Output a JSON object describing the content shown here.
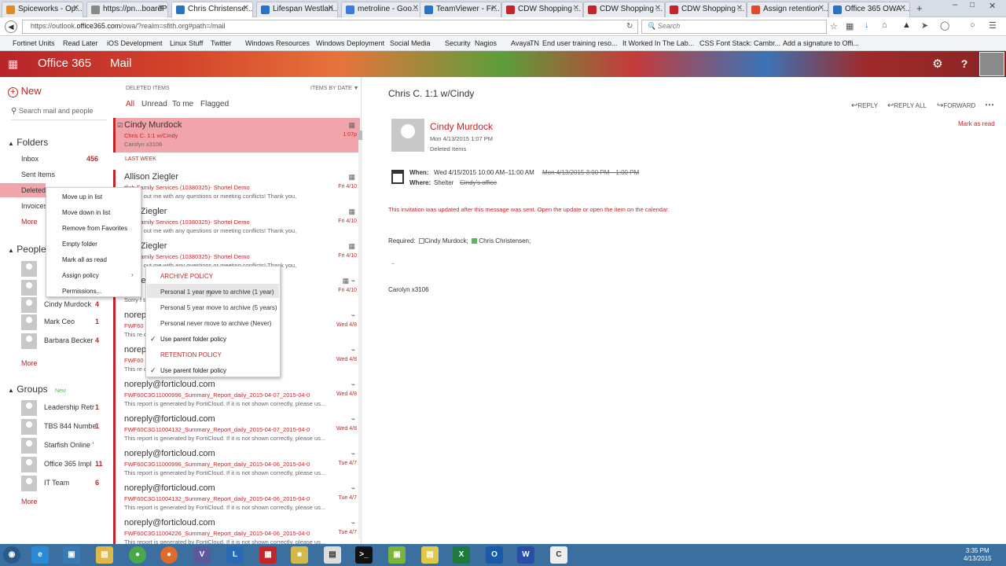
{
  "browser": {
    "tabs": [
      {
        "label": "Spiceworks - Op...",
        "color": "#e08a2a"
      },
      {
        "label": "https://pn...boardPage",
        "color": "#888888"
      },
      {
        "label": "Chris Christense...",
        "color": "#2a72c4"
      },
      {
        "label": "Lifespan Westlan...",
        "color": "#2a72c4"
      },
      {
        "label": "metroline - Goo...",
        "color": "#3a7be0"
      },
      {
        "label": "TeamViewer - Fr...",
        "color": "#2a72c4"
      },
      {
        "label": "CDW Shopping ...",
        "color": "#c2262b"
      },
      {
        "label": "CDW Shopping ...",
        "color": "#c2262b"
      },
      {
        "label": "CDW Shopping ...",
        "color": "#c2262b"
      },
      {
        "label": "Assign retention ...",
        "color": "#e04a2a"
      },
      {
        "label": "Office 365 OWA ...",
        "color": "#2a72c4"
      }
    ],
    "url_prefix": "https://outlook.",
    "url_domain": "office365.com",
    "url_rest": "/owa/?realm=sfith.org#path=/mail",
    "search_placeholder": "Search",
    "bookmarks": [
      "Fortinet Units",
      "Read Later",
      "iOS Development",
      "Linux Stuff",
      "Twitter",
      "Windows Resources",
      "Windows Deployment",
      "Social Media",
      "Security",
      "Nagios",
      "Avaya",
      "TN",
      "End user training reso...",
      "It Worked In The Lab...",
      "CSS Font Stack: Cambr...",
      "Add a signature to Offi..."
    ]
  },
  "o365": {
    "brand": "Office 365",
    "app": "Mail"
  },
  "leftnav": {
    "new_label": "New",
    "search_placeholder": "Search mail and people",
    "folders_header": "Folders",
    "folders": [
      {
        "label": "Inbox",
        "count": "456"
      },
      {
        "label": "Sent Items",
        "count": ""
      },
      {
        "label": "Deleted",
        "count": ""
      },
      {
        "label": "Invoices",
        "count": ""
      }
    ],
    "more": "More",
    "people_header": "People",
    "people": [
      {
        "name": "Cindy Murdock",
        "count": "4"
      },
      {
        "name": "Mark Ceo",
        "count": "1"
      },
      {
        "name": "Barbara Becker",
        "count": "4"
      }
    ],
    "groups_header": "Groups",
    "groups_new": "New",
    "groups": [
      {
        "name": "Leadership Retr",
        "count": "1"
      },
      {
        "name": "TBS 844 Numbe",
        "count": "1"
      },
      {
        "name": "Starfish Online '",
        "count": ""
      },
      {
        "name": "Office 365 Impl",
        "count": "11"
      },
      {
        "name": "IT Team",
        "count": "6"
      }
    ]
  },
  "context_menu": {
    "items": [
      "Move up in list",
      "Move down in list",
      "Remove from Favorites",
      "Empty folder",
      "Mark all as read",
      "Assign policy",
      "Permissions..."
    ],
    "submenu": {
      "archive_header": "ARCHIVE POLICY",
      "archive_items": [
        "Personal 1 year move to archive (1 year)",
        "Personal 5 year move to archive (5 years)",
        "Personal never move to archive (Never)",
        "Use parent folder policy"
      ],
      "retention_header": "RETENTION POLICY",
      "retention_items": [
        "Use parent folder policy"
      ]
    }
  },
  "msglist": {
    "folder_label": "DELETED ITEMS",
    "sort_label": "ITEMS BY DATE",
    "filters": [
      "All",
      "Unread",
      "To me",
      "Flagged"
    ],
    "last_week": "LAST WEEK",
    "messages": [
      {
        "from": "Cindy Murdock",
        "subject": "Chris C. 1:1 w/Cindy",
        "preview": "Carolyn x3106",
        "date": "1:07p"
      },
      {
        "from": "Allison Ziegler",
        "subject": "tfish Family Services (10380325)- Shortel Demo",
        "preview": "l reach out me with any questions or meeting conflicts! Thank you,",
        "date": "Fri 4/10"
      },
      {
        "from": "son Ziegler",
        "subject": "tfish Family Services (10380325)- Shortel Demo",
        "preview": "l reach out me with any questions or meeting conflicts! Thank you,",
        "date": "Fri 4/10"
      },
      {
        "from": "son Ziegler",
        "subject": "tfish Family Services (10380325)- Shortel Demo",
        "preview": "l reach out me with any questions or meeting conflicts! Thank you,",
        "date": "Fri 4/10"
      },
      {
        "from": "shoretel.c",
        "subject": "",
        "preview": "Sorry f                                              time/2pm eastern...",
        "date": "Fri 4/10"
      },
      {
        "from": "noreply",
        "subject": "FWF60                                      y_2015-04-0",
        "preview": "This re                                       orrectly, please us...",
        "date": "Wed 4/8"
      },
      {
        "from": "noreply",
        "subject": "FWF60                                      y_2015-04-0",
        "preview": "This re                                       orrectly, please us...",
        "date": "Wed 4/8"
      },
      {
        "from": "noreply@forticloud.com",
        "subject": "FWF60C3G11000996_Summary_Report_daily_2015-04-07_2015-04-0",
        "preview": "This report is generated by FortiCloud. If it is not shown correctly, please us...",
        "date": "Wed 4/8"
      },
      {
        "from": "noreply@forticloud.com",
        "subject": "FWF60C3G11004132_Summary_Report_daily_2015-04-07_2015-04-0",
        "preview": "This report is generated by FortiCloud. If it is not shown correctly, please us...",
        "date": "Wed 4/8"
      },
      {
        "from": "noreply@forticloud.com",
        "subject": "FWF60C3G11000996_Summary_Report_daily_2015-04-06_2015-04-0",
        "preview": "This report is generated by FortiCloud. If it is not shown correctly, please us...",
        "date": "Tue 4/7"
      },
      {
        "from": "noreply@forticloud.com",
        "subject": "FWF60C3G11004132_Summary_Report_daily_2015-04-06_2015-04-0",
        "preview": "This report is generated by FortiCloud. If it is not shown correctly, please us...",
        "date": "Tue 4/7"
      },
      {
        "from": "noreply@forticloud.com",
        "subject": "FWF60C3G11004226_Summary_Report_daily_2015-04-06_2015-04-0",
        "preview": "This report is generated by FortiCloud. If it is not shown correctly, please us...",
        "date": "Tue 4/7"
      }
    ]
  },
  "reading": {
    "title": "Chris C. 1:1 w/Cindy",
    "reply": "REPLY",
    "reply_all": "REPLY ALL",
    "forward": "FORWARD",
    "mark_read": "Mark as read",
    "sender": "Cindy Murdock",
    "sent_date": "Mon 4/13/2015 1:07 PM",
    "folder": "Deleted Items",
    "when_label": "When:",
    "when_value": "Wed 4/15/2015 10:00 AM–11:00 AM",
    "when_old": "Mon 4/13/2015 3:00 PM—1:00 PM",
    "where_label": "Where:",
    "where_value": "Shelter",
    "where_old": "Cindy's office",
    "warning": "This invitation was updated after this message was sent. Open the update or open the item on the calendar.",
    "required_label": "Required:",
    "attendees": [
      "Cindy Murdock;",
      "Chris Christensen;"
    ],
    "dash": "–",
    "signature": "Carolyn x3106"
  },
  "taskbar": {
    "time": "3:35 PM",
    "date": "4/13/2015"
  }
}
